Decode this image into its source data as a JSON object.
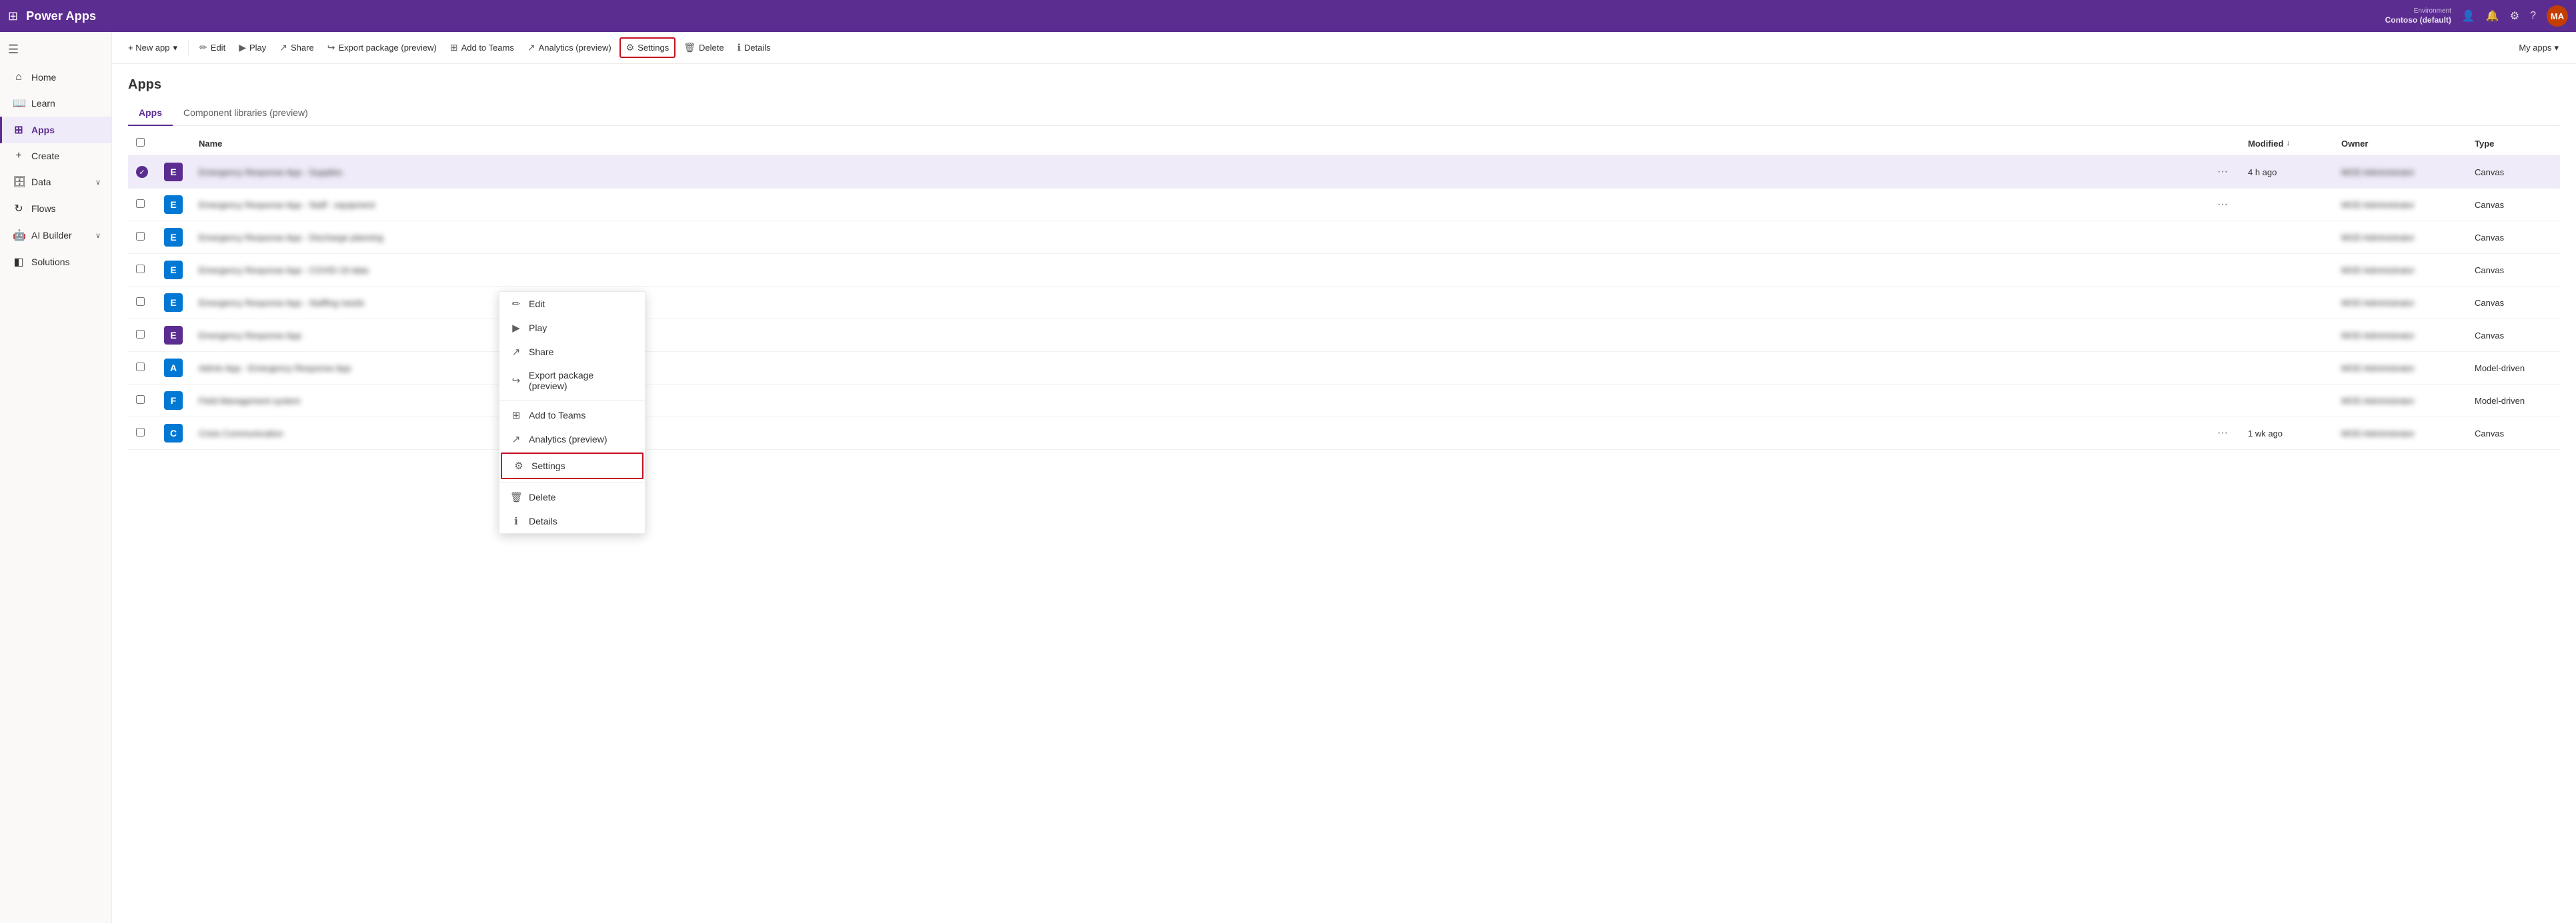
{
  "topbar": {
    "waffle": "⊞",
    "title": "Power Apps",
    "environment_label": "Environment",
    "environment_name": "Contoso (default)",
    "avatar_initials": "MA"
  },
  "sidebar": {
    "collapse_icon": "☰",
    "items": [
      {
        "id": "home",
        "label": "Home",
        "icon": "⌂",
        "active": false
      },
      {
        "id": "learn",
        "label": "Learn",
        "icon": "📖",
        "active": false
      },
      {
        "id": "apps",
        "label": "Apps",
        "icon": "⊞",
        "active": true
      },
      {
        "id": "create",
        "label": "Create",
        "icon": "+",
        "active": false
      },
      {
        "id": "data",
        "label": "Data",
        "icon": "🗄",
        "active": false,
        "has_chevron": true
      },
      {
        "id": "flows",
        "label": "Flows",
        "icon": "↻",
        "active": false
      },
      {
        "id": "ai-builder",
        "label": "AI Builder",
        "icon": "🤖",
        "active": false,
        "has_chevron": true
      },
      {
        "id": "solutions",
        "label": "Solutions",
        "icon": "◧",
        "active": false
      }
    ]
  },
  "toolbar": {
    "new_app_label": "+ New app",
    "new_app_chevron": "▾",
    "edit_label": "Edit",
    "play_label": "Play",
    "share_label": "Share",
    "export_label": "Export package (preview)",
    "add_to_teams_label": "Add to Teams",
    "analytics_label": "Analytics (preview)",
    "settings_label": "Settings",
    "delete_label": "Delete",
    "details_label": "Details",
    "my_apps_label": "My apps",
    "my_apps_chevron": "▾"
  },
  "page": {
    "title": "Apps",
    "tabs": [
      {
        "id": "apps",
        "label": "Apps",
        "active": true
      },
      {
        "id": "component-libraries",
        "label": "Component libraries (preview)",
        "active": false
      }
    ]
  },
  "table": {
    "columns": [
      {
        "id": "select",
        "label": ""
      },
      {
        "id": "icon",
        "label": ""
      },
      {
        "id": "name",
        "label": "Name"
      },
      {
        "id": "dots",
        "label": ""
      },
      {
        "id": "modified",
        "label": "Modified"
      },
      {
        "id": "owner",
        "label": "Owner"
      },
      {
        "id": "type",
        "label": "Type"
      }
    ],
    "rows": [
      {
        "id": 1,
        "selected": true,
        "icon_color": "#5c2d91",
        "icon_text": "E",
        "name": "Emergency Response App - Supplies",
        "blurred": true,
        "dots": "···",
        "modified": "4 h ago",
        "owner": "MOD Administrator",
        "owner_blurred": true,
        "type": "Canvas",
        "show_context": true
      },
      {
        "id": 2,
        "selected": false,
        "icon_color": "#0078d4",
        "icon_text": "E",
        "name": "Emergency Response App - Staff - equipment",
        "blurred": true,
        "dots": "···",
        "modified": "",
        "owner": "MOD Administrator",
        "owner_blurred": true,
        "type": "Canvas"
      },
      {
        "id": 3,
        "selected": false,
        "icon_color": "#0078d4",
        "icon_text": "E",
        "name": "Emergency Response App - Discharge planning",
        "blurred": true,
        "dots": "",
        "modified": "",
        "owner": "MOD Administrator",
        "owner_blurred": true,
        "type": "Canvas"
      },
      {
        "id": 4,
        "selected": false,
        "icon_color": "#0078d4",
        "icon_text": "E",
        "name": "Emergency Response App - COVID-19 data",
        "blurred": true,
        "dots": "",
        "modified": "",
        "owner": "MOD Administrator",
        "owner_blurred": true,
        "type": "Canvas"
      },
      {
        "id": 5,
        "selected": false,
        "icon_color": "#0078d4",
        "icon_text": "E",
        "name": "Emergency Response App - Staffing needs",
        "blurred": true,
        "dots": "",
        "modified": "",
        "owner": "MOD Administrator",
        "owner_blurred": true,
        "type": "Canvas"
      },
      {
        "id": 6,
        "selected": false,
        "icon_color": "#5c2d91",
        "icon_text": "E",
        "name": "Emergency Response App",
        "blurred": true,
        "dots": "",
        "modified": "",
        "owner": "MOD Administrator",
        "owner_blurred": true,
        "type": "Canvas"
      },
      {
        "id": 7,
        "selected": false,
        "icon_color": "#0078d4",
        "icon_text": "A",
        "name": "Admin App - Emergency Response App",
        "blurred": true,
        "dots": "",
        "modified": "",
        "owner": "MOD Administrator",
        "owner_blurred": true,
        "type": "Model-driven"
      },
      {
        "id": 8,
        "selected": false,
        "icon_color": "#0078d4",
        "icon_text": "F",
        "name": "Field Management system",
        "blurred": true,
        "dots": "",
        "modified": "",
        "owner": "MOD Administrator",
        "owner_blurred": true,
        "type": "Model-driven"
      },
      {
        "id": 9,
        "selected": false,
        "icon_color": "#0078d4",
        "icon_text": "C",
        "name": "Crisis Communication",
        "blurred": true,
        "dots": "···",
        "modified": "1 wk ago",
        "owner": "MOD Administrator",
        "owner_blurred": true,
        "type": "Canvas"
      }
    ]
  },
  "context_menu": {
    "items": [
      {
        "id": "edit",
        "label": "Edit",
        "icon": "✏"
      },
      {
        "id": "play",
        "label": "Play",
        "icon": "▶"
      },
      {
        "id": "share",
        "label": "Share",
        "icon": "↗"
      },
      {
        "id": "export",
        "label": "Export package (preview)",
        "icon": "↪"
      },
      {
        "id": "add-to-teams",
        "label": "Add to Teams",
        "icon": "⊞"
      },
      {
        "id": "analytics",
        "label": "Analytics (preview)",
        "icon": "↗"
      },
      {
        "id": "settings",
        "label": "Settings",
        "icon": "⚙",
        "highlighted": true
      },
      {
        "id": "delete",
        "label": "Delete",
        "icon": "🗑"
      },
      {
        "id": "details",
        "label": "Details",
        "icon": "ℹ"
      }
    ]
  }
}
